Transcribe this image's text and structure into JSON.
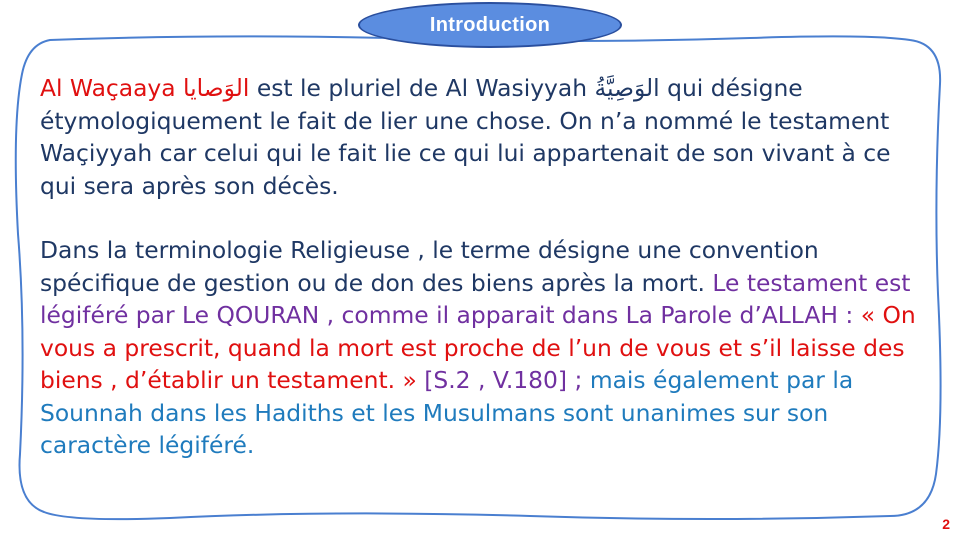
{
  "title": "Introduction",
  "paragraph1": {
    "term_latin": "Al Waçaaya",
    "term_arabic": "الوَصايا",
    "text_a": "est le pluriel de Al Wasiyyah",
    "term_arabic_singular": "الوَصِيَّةُ",
    "text_b": "qui désigne étymologiquement le fait de lier une chose. On n’a nommé le testament Waçiyyah car celui qui le fait lie ce qui lui appartenait de son vivant à ce qui sera après son décès."
  },
  "paragraph2": {
    "text_a": "Dans la terminologie Religieuse , le terme désigne une convention spécifique de gestion ou de don des biens après la mort.",
    "text_purple": "Le testament est légiféré par Le QOURAN , comme il apparait dans La Parole d’ALLAH :",
    "quote": "« On vous a prescrit, quand la mort est proche de l’un de vous et s’il laisse des biens , d’établir un testament. »",
    "reference": "[S.2 , V.180] ;",
    "text_blue": "mais également par la Sounnah dans les Hadiths et les Musulmans sont unanimes sur son caractère légiféré."
  },
  "page_number": "2",
  "colors": {
    "navy": "#1f3864",
    "red": "#e01010",
    "purple": "#7030a0",
    "blue": "#1f7bbd",
    "pill": "#5b8de0"
  }
}
